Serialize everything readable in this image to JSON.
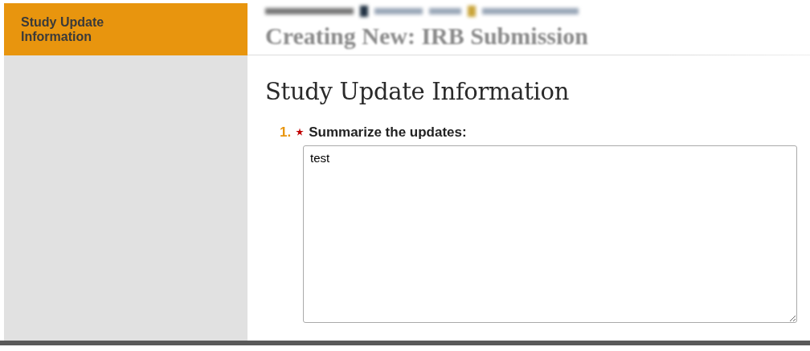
{
  "sidebar": {
    "items": [
      {
        "label": "Study Update Information",
        "selected": true
      }
    ]
  },
  "header": {
    "title": "Creating New: IRB Submission"
  },
  "section": {
    "title": "Study Update Information"
  },
  "questions": [
    {
      "number": "1.",
      "required": true,
      "label": "Summarize the updates:",
      "value": "test"
    }
  ]
}
